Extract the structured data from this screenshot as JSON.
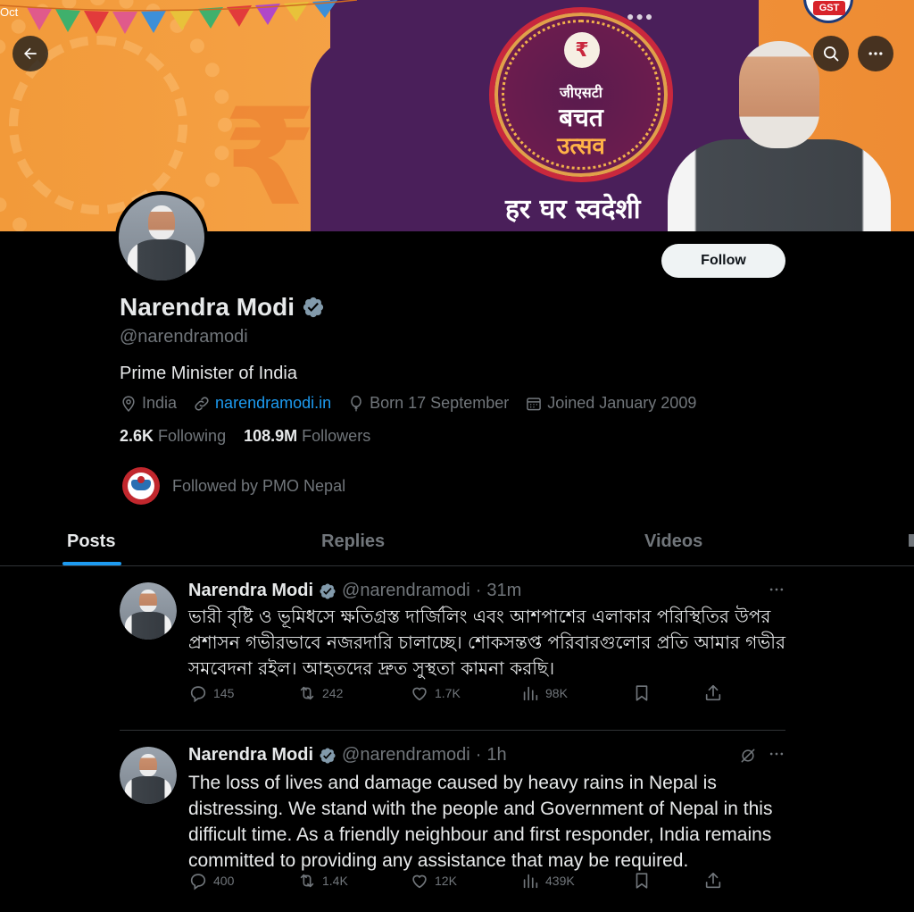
{
  "banner": {
    "date_fragment": "Oct",
    "emblem_line1": "जीएसटी",
    "emblem_line2": "बचत",
    "emblem_line3": "उत्सव",
    "slogan": "हर घर स्वदेशी",
    "gst_badge": "GST",
    "rupee_symbol": "₹"
  },
  "nav": {
    "back_icon": "arrow-left-icon",
    "search_icon": "search-icon",
    "more_icon": "more-horizontal-icon"
  },
  "profile": {
    "name": "Narendra Modi",
    "handle": "@narendramodi",
    "bio": "Prime Minister of India",
    "location": "India",
    "website": "narendramodi.in",
    "birthday": "Born 17 September",
    "joined": "Joined January 2009",
    "following_count": "2.6K",
    "following_label": "Following",
    "followers_count": "108.9M",
    "followers_label": "Followers",
    "followed_by": "Followed by PMO Nepal",
    "follow_button": "Follow"
  },
  "tabs": [
    {
      "label": "Posts",
      "active": true
    },
    {
      "label": "Replies",
      "active": false
    },
    {
      "label": "Videos",
      "active": false
    }
  ],
  "posts": [
    {
      "name": "Narendra Modi",
      "handle": "@narendramodi",
      "separator": "·",
      "time": "31m",
      "text": "ভারী বৃষ্টি ও ভূমিধসে ক্ষতিগ্রস্ত দার্জিলিং এবং আশপাশের এলাকার পরিস্থিতির উপর প্রশাসন গভীরভাবে নজরদারি চালাচ্ছে। শোকসন্তপ্ত পরিবারগুলোর প্রতি আমার গভীর সমবেদনা রইল। আহতদের দ্রুত সুস্থতা কামনা করছি।",
      "replies": "145",
      "reposts": "242",
      "likes": "1.7K",
      "views": "98K"
    },
    {
      "name": "Narendra Modi",
      "handle": "@narendramodi",
      "separator": "·",
      "time": "1h",
      "text": "The loss of lives and damage caused by heavy rains in Nepal is distressing. We stand with the people and Government of Nepal in this difficult time. As a friendly neighbour and first responder, India remains committed to providing any assistance that may be required.",
      "replies": "400",
      "reposts": "1.4K",
      "likes": "12K",
      "views": "439K"
    }
  ],
  "colors": {
    "background": "#000000",
    "accent": "#1d9bf0",
    "secondary_text": "#71767b",
    "primary_text": "#e7e9ea",
    "verified": "#829aab"
  }
}
